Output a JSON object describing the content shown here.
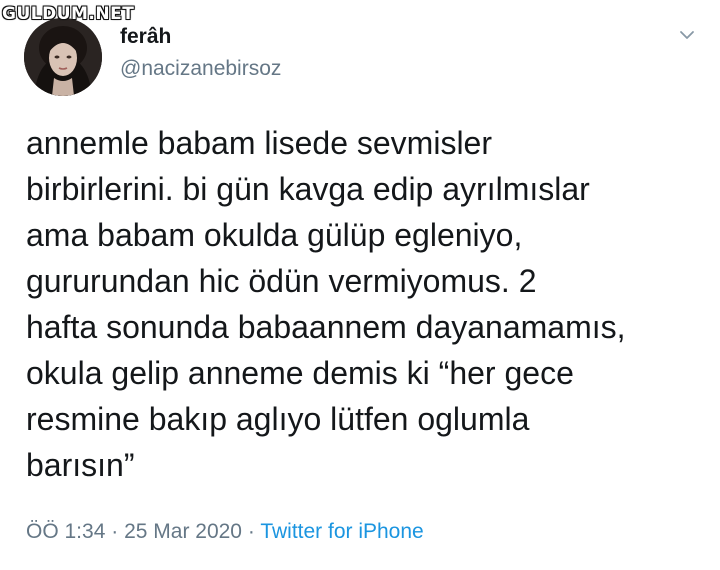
{
  "watermark": "GULDUM.NET",
  "tweet": {
    "author": {
      "display_name": "ferâh",
      "handle": "@nacizanebirsoz"
    },
    "text_lines": [
      "annemle babam lisede sevmisler",
      "birbirlerini. bi gün kavga edip ayrılmıslar",
      "ama babam okulda gülüp egleniyo,",
      "gururundan hic ödün vermiyomus. 2",
      "hafta sonunda babaannem dayanamamıs,",
      "okula gelip anneme demis ki “her gece",
      "resmine bakıp aglıyo lütfen oglumla",
      "barısın”"
    ],
    "meta": {
      "time": "ÖÖ 1:34",
      "separator": "·",
      "date": "25 Mar 2020",
      "source": "Twitter for iPhone"
    },
    "menu_icon": "chevron-down-icon",
    "colors": {
      "text": "#14171a",
      "muted": "#657786",
      "link": "#1b95e0"
    }
  }
}
